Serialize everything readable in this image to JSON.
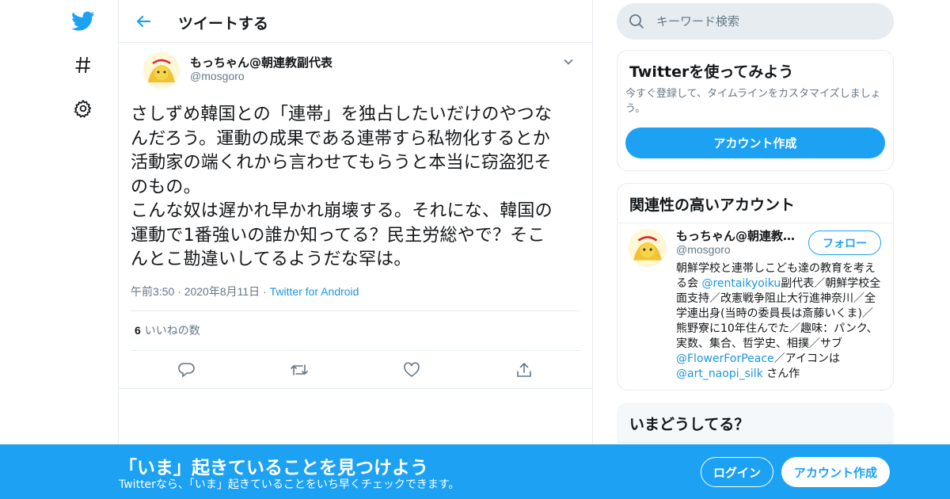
{
  "colors": {
    "accent": "#1da1f2",
    "text": "#14171a",
    "muted": "#657786",
    "border": "#e6ecf0"
  },
  "nav": {
    "icons": [
      "twitter-logo-icon",
      "hashtag-icon",
      "gear-icon"
    ]
  },
  "main": {
    "title": "ツイートする"
  },
  "tweet": {
    "author_name": "もっちゃん@朝連教副代表",
    "author_handle": "@mosgoro",
    "text": "さしずめ韓国との「連帯」を独占したいだけのやつな\nんだろう。運動の成果である連帯すら私物化するとか\n活動家の端くれから言わせてもらうと本当に窃盗犯そ\nのもの。\nこんな奴は遅かれ早かれ崩壊する。それにな、韓国の\n運動で1番強いの誰か知ってる？民主労総やで？そこ\nんとこ勘違いしてるようだな罕は。",
    "time": "午前3:50",
    "date": "2020年8月11日",
    "source": "Twitter for Android",
    "likes_count": "6",
    "likes_label": "いいねの数"
  },
  "search": {
    "placeholder": "キーワード検索"
  },
  "try_card": {
    "title": "Twitterを使ってみよう",
    "desc": "今すぐ登録して、タイムラインをカスタマイズしましょう。",
    "button": "アカウント作成"
  },
  "related": {
    "title": "関連性の高いアカウント",
    "name": "もっちゃん@朝連教副代表",
    "handle": "@mosgoro",
    "follow": "フォロー",
    "bio": {
      "p1": "朝鮮学校と連帯しこども達の教育を考える会 ",
      "l1": "@rentaikyoiku",
      "p2": "副代表／朝鮮学校全面支持／改憲戦争阻止大行進神奈川／全学連出身(当時の委員長は斎藤いくま)／熊野寮に10年住んでた／趣味：パンク、実数、集合、哲学史、相撲／サブ",
      "l2": "@FlowerForPeace",
      "p3": "／アイコンは ",
      "l3": "@art_naopi_silk",
      "p4": " さん作"
    }
  },
  "trends": {
    "title": "いまどうしてる？"
  },
  "bottom": {
    "title": "「いま」起きていることを見つけよう",
    "subtitle": "Twitterなら、「いま」起きていることをいち早くチェックできます。",
    "login": "ログイン",
    "signup": "アカウント作成"
  }
}
